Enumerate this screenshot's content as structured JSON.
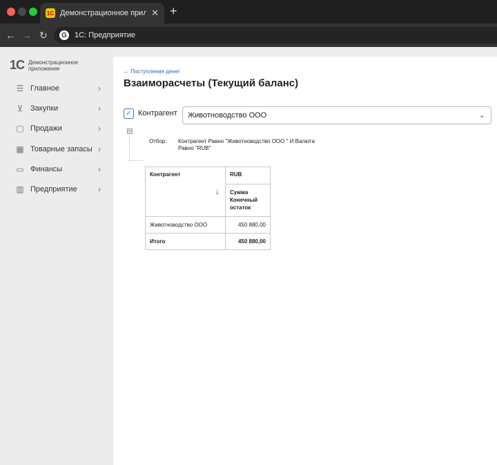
{
  "browser": {
    "tab_title": "Демонстрационное прилож",
    "tab_favicon": "1С",
    "new_tab_icon": "+",
    "address": "1С: Предприятие"
  },
  "sidebar": {
    "logo_mark": "1С",
    "logo_text": "Демонстрационное приложение",
    "items": [
      {
        "label": "Главное",
        "icon": "list-icon"
      },
      {
        "label": "Закупки",
        "icon": "cart-icon"
      },
      {
        "label": "Продажи",
        "icon": "bag-icon"
      },
      {
        "label": "Товарные запасы",
        "icon": "boxes-icon"
      },
      {
        "label": "Финансы",
        "icon": "wallet-icon"
      },
      {
        "label": "Предприятие",
        "icon": "building-icon"
      }
    ]
  },
  "main": {
    "breadcrumb": "← Поступления денег",
    "title": "Взаиморасчеты (Текущий баланс)",
    "filter": {
      "checked": true,
      "label": "Контрагент",
      "value": "Животноводство ООО"
    },
    "report": {
      "filter_key": "Отбор:",
      "filter_desc": "Контрагент Равно \"Животноводство ООО \" И Валюта Равно \"RUB\"",
      "table": {
        "col_contragent": "Контрагент",
        "col_currency": "RUB",
        "col_sum": "Сумма Конечный остаток",
        "rows": [
          {
            "name": "Животноводство ООО",
            "value": "450 880,00"
          }
        ],
        "total_label": "Итого",
        "total_value": "450 880,00"
      }
    }
  }
}
